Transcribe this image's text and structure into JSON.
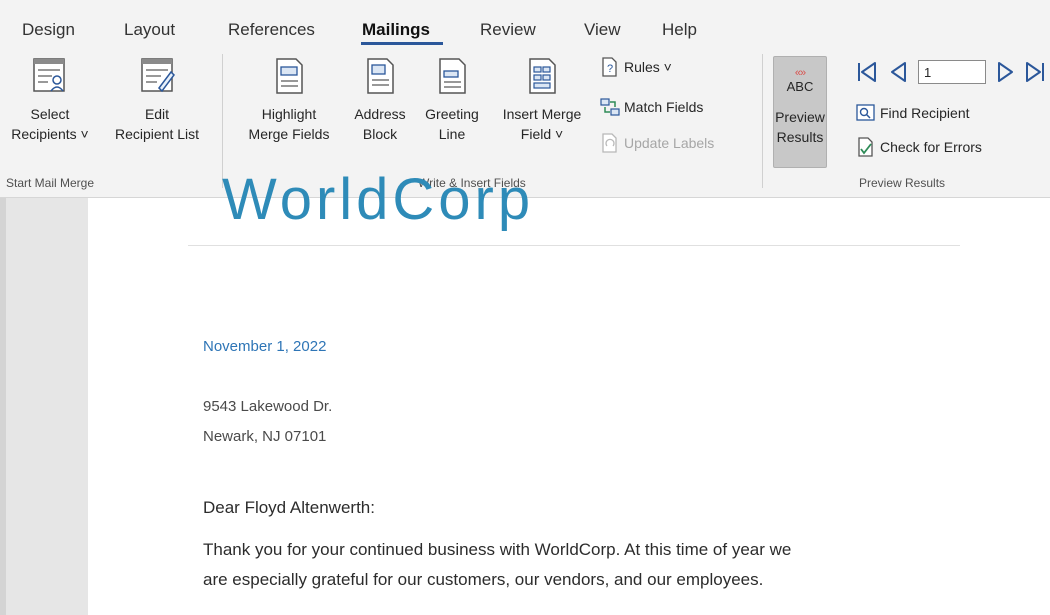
{
  "tabs": [
    "Design",
    "Layout",
    "References",
    "Mailings",
    "Review",
    "View",
    "Help"
  ],
  "ribbon": {
    "start_mail_merge": {
      "select_recipients": [
        "Select",
        "Recipients ˅"
      ],
      "edit_recipient_list": [
        "Edit",
        "Recipient List"
      ],
      "group_label": "Start Mail Merge"
    },
    "write_insert": {
      "highlight": [
        "Highlight",
        "Merge Fields"
      ],
      "address_block": [
        "Address",
        "Block"
      ],
      "greeting_line": [
        "Greeting",
        "Line"
      ],
      "insert_merge_field": [
        "Insert Merge",
        "Field ˅"
      ],
      "rules": "Rules ˅",
      "match_fields": "Match Fields",
      "update_labels": "Update Labels",
      "group_label": "Write & Insert Fields"
    },
    "preview": {
      "abc_label": "ABC",
      "preview_results": [
        "Preview",
        "Results"
      ],
      "record_value": "1",
      "find_recipient": "Find Recipient",
      "check_errors": "Check for Errors",
      "group_label": "Preview Results"
    }
  },
  "document": {
    "logo_text": "WorldCorp",
    "date": "November 1, 2022",
    "address_line1": "9543 Lakewood Dr.",
    "address_line2": "Newark, NJ  07101",
    "greeting": "Dear Floyd Altenwerth:",
    "body_line1": "Thank you for your continued business with WorldCorp.  At this time of year we",
    "body_line2": "are especially grateful for our customers, our vendors, and our employees."
  },
  "colors": {
    "accent": "#2b579a",
    "logo": "#2e8bb8",
    "date": "#2e75b6",
    "preview_active": "#c8c8c8"
  }
}
